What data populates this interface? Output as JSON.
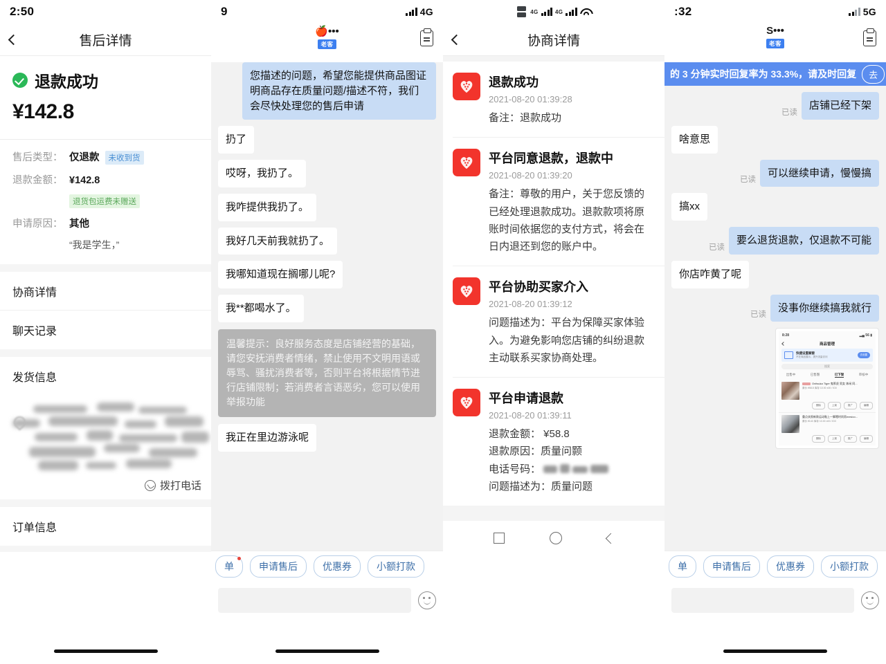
{
  "panel1": {
    "status": {
      "time": "2:50"
    },
    "nav": {
      "title": "售后详情",
      "back_icon": "chevron-left-icon"
    },
    "result": {
      "status_text": "退款成功",
      "amount": "¥142.8"
    },
    "fields": [
      {
        "key": "售后类型：",
        "value": "仅退款",
        "tag": "未收到货"
      },
      {
        "key": "退款金额：",
        "value": "¥142.8",
        "sub_tag": "退货包运费未赠送"
      },
      {
        "key": "申请原因：",
        "value": "其他",
        "quote": "“我是学生，”"
      }
    ],
    "rows": [
      "协商详情",
      "聊天记录",
      "发货信息",
      "订单信息"
    ],
    "call_label": "拨打电话"
  },
  "panel2": {
    "status": {
      "time": "9",
      "network": "4G"
    },
    "header": {
      "peer": "🍎•••",
      "badge": "老客",
      "clipboard_icon": "clipboard-icon"
    },
    "messages": [
      {
        "side": "out",
        "text": "您描述的问题，希望您能提供商品图证明商品存在质量问题/描述不符，我们会尽快处理您的售后申请"
      },
      {
        "side": "in",
        "text": "扔了"
      },
      {
        "side": "in",
        "text": "哎呀，我扔了。"
      },
      {
        "side": "in",
        "text": "我咋提供我扔了。"
      },
      {
        "side": "in",
        "text": "我好几天前我就扔了。"
      },
      {
        "side": "in",
        "text": "我哪知道现在搁哪儿呢?"
      },
      {
        "side": "in",
        "text": "我**都喝水了。"
      }
    ],
    "tip": "温馨提示：良好服务态度是店铺经营的基础，请您安抚消费者情绪，禁止使用不文明用语或辱骂、骚扰消费者等，否则平台将根据情节进行店铺限制；若消费者言语恶劣，您可以使用举报功能",
    "last_partial": "我正在里边游泳呢",
    "chips": [
      "单",
      "申请售后",
      "优惠券",
      "小额打款"
    ],
    "input_placeholder": "",
    "smiley_icon": "smiley-icon"
  },
  "panel3": {
    "status": {
      "icons": "dual-sim-signal-wifi"
    },
    "nav": {
      "title": "协商详情",
      "back_icon": "chevron-left-icon"
    },
    "items": [
      {
        "title": "退款成功",
        "time": "2021-08-20 01:39:28",
        "lines": [
          "备注：退款成功"
        ]
      },
      {
        "title": "平台同意退款，退款中",
        "time": "2021-08-20 01:39:20",
        "lines": [
          "备注：尊敬的用户，关于您反馈的",
          "已经处理退款成功。退款款项将原",
          "账时间依据您的支付方式，将会在",
          "日内退还到您的账户中。"
        ]
      },
      {
        "title": "平台协助买家介入",
        "time": "2021-08-20 01:39:12",
        "lines": [
          "问题描述为：平台为保障买家体验",
          "入。为避免影响您店铺的纠纷退款",
          "主动联系买家协商处理。"
        ]
      },
      {
        "title": "平台申请退款",
        "time": "2021-08-20 01:39:11",
        "lines": [
          "退款金额： ¥58.8",
          "退款原因：质量问颢",
          "电话号码：",
          "问题描述为：质量问题"
        ],
        "masked_line_index": 2
      }
    ],
    "android_nav": [
      "recents-square-icon",
      "home-circle-icon",
      "back-chevron-icon"
    ]
  },
  "panel4": {
    "status": {
      "time": ":32",
      "network": "5G"
    },
    "header": {
      "peer": "S•••",
      "badge": "老客",
      "clipboard_icon": "clipboard-icon"
    },
    "banner": {
      "text": "的 3 分钟实时回复率为 33.3%，请及时回复",
      "button": "去"
    },
    "messages": [
      {
        "side": "out",
        "text": "店铺已经下架",
        "read": "已读"
      },
      {
        "side": "in",
        "text": "啥意思"
      },
      {
        "side": "out",
        "text": "可以继续申请，慢慢搞",
        "read": "已读"
      },
      {
        "side": "in",
        "text": "搞xx"
      },
      {
        "side": "out",
        "text": "要么退货退款，仅退款不可能",
        "read": "已读"
      },
      {
        "side": "in",
        "text": "你店咋黄了呢"
      },
      {
        "side": "out",
        "text": "没事你继续搞我就行",
        "read": "已读"
      }
    ],
    "screenshot_card": {
      "status_time": "8:28",
      "nav_title": "商品管理",
      "promo": {
        "title": "快捷设置橱窗",
        "sub": "不在商品展示，提升流量访问",
        "button": "去设置"
      },
      "search_placeholder": "搜索",
      "tabs": [
        "出售中",
        "已售罄",
        "已下架",
        "审核中"
      ],
      "active_tab_index": 2,
      "items": [
        {
          "title": "Onitsuka Tiger 鬼冢虎 男女 休闲 同...",
          "line1": "原价 ¥58.8",
          "line2": "库存 10.00",
          "line3": "x00 / ID0"
        },
        {
          "title": "重点关照新款运动鞋上一脚蹬时尚男mesico...",
          "line1": "原价 ¥143",
          "line2": "库存 10.00",
          "line3": "x00 / ID0"
        }
      ],
      "item_buttons": [
        "删除",
        "上架",
        "推广",
        "编辑"
      ]
    },
    "chips": [
      "单",
      "申请售后",
      "优惠券",
      "小额打款"
    ],
    "smiley_icon": "smiley-icon"
  }
}
